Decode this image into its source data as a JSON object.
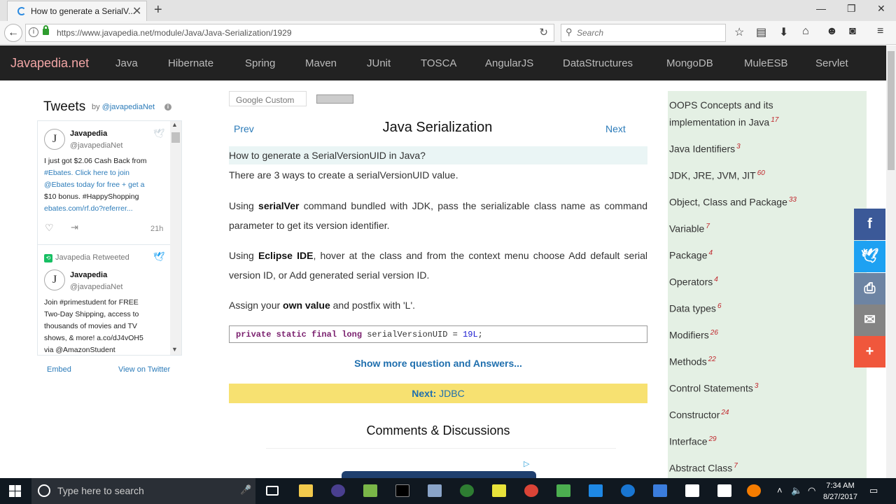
{
  "browser": {
    "tab_title": "How to generate a SerialV...",
    "url": "https://www.javapedia.net/module/Java/Java-Serialization/1929",
    "search_placeholder": "Search"
  },
  "site": {
    "logo": "Javapedia.net",
    "nav": [
      "Java",
      "Hibernate",
      "Spring",
      "Maven",
      "JUnit",
      "TOSCA",
      "AngularJS",
      "DataStructures",
      "MongoDB",
      "MuleESB",
      "Servlet"
    ]
  },
  "tweets": {
    "title": "Tweets",
    "by_prefix": "by",
    "by_handle": "@javapediaNet",
    "tweet1": {
      "name": "Javapedia",
      "handle": "@javapediaNet",
      "lines": [
        "I just got $2.06 Cash Back from",
        "#Ebates. Click here to join",
        "@Ebates today for free + get a",
        "$10 bonus. #HappyShopping",
        "ebates.com/rf.do?referrer..."
      ],
      "time": "21h"
    },
    "retweet_label": "Javapedia Retweeted",
    "tweet2": {
      "name": "Javapedia",
      "handle": "@javapediaNet",
      "lines": [
        "Join #primestudent for FREE",
        "Two-Day Shipping, access to",
        "thousands of movies and TV",
        "shows, & more! a.co/dJ4vOH5",
        "via @AmazonStudent"
      ]
    },
    "embed": "Embed",
    "view_on_twitter": "View on Twitter"
  },
  "main": {
    "google_custom": "Google Custom",
    "prev": "Prev",
    "next": "Next",
    "title": "Java Serialization",
    "question": "How to generate a SerialVersionUID in Java?",
    "intro": "There are 3 ways to create a serialVersionUID value.",
    "p1_a": "Using ",
    "p1_b": "serialVer",
    "p1_c": " command bundled with JDK, pass the serializable class name as command parameter to get its version identifier.",
    "p2_a": "Using ",
    "p2_b": "Eclipse IDE",
    "p2_c": ", hover at the class and from the context menu choose Add default serial version ID, or Add generated serial version ID.",
    "p3_a": "Assign your ",
    "p3_b": "own value",
    "p3_c": " and postfix with 'L'.",
    "code_kw": "private static final long",
    "code_mid": " serialVersionUID = ",
    "code_num": "19L",
    "code_end": ";",
    "show_more": "Show more question and Answers...",
    "next_label": "Next:",
    "next_topic": "JDBC",
    "comments": "Comments & Discussions"
  },
  "sidebar": {
    "items": [
      {
        "label": "OOPS Concepts and its implementation in Java",
        "count": "17"
      },
      {
        "label": "Java Identifiers",
        "count": "3"
      },
      {
        "label": "JDK, JRE, JVM, JIT",
        "count": "60"
      },
      {
        "label": "Object, Class and Package",
        "count": "33"
      },
      {
        "label": "Variable",
        "count": "7"
      },
      {
        "label": "Package",
        "count": "4"
      },
      {
        "label": "Operators",
        "count": "4"
      },
      {
        "label": "Data types",
        "count": "6"
      },
      {
        "label": "Modifiers",
        "count": "26"
      },
      {
        "label": "Methods",
        "count": "22"
      },
      {
        "label": "Control Statements",
        "count": "3"
      },
      {
        "label": "Constructor",
        "count": "24"
      },
      {
        "label": "Interface",
        "count": "29"
      },
      {
        "label": "Abstract Class",
        "count": "7"
      }
    ]
  },
  "share": {
    "facebook_color": "#3b5998",
    "twitter_color": "#1da1f2",
    "print_color": "#6d84a3",
    "email_color": "#848484",
    "more_color": "#f0573c"
  },
  "taskbar": {
    "search_placeholder": "Type here to search",
    "time": "7:34 AM",
    "date": "8/27/2017"
  }
}
